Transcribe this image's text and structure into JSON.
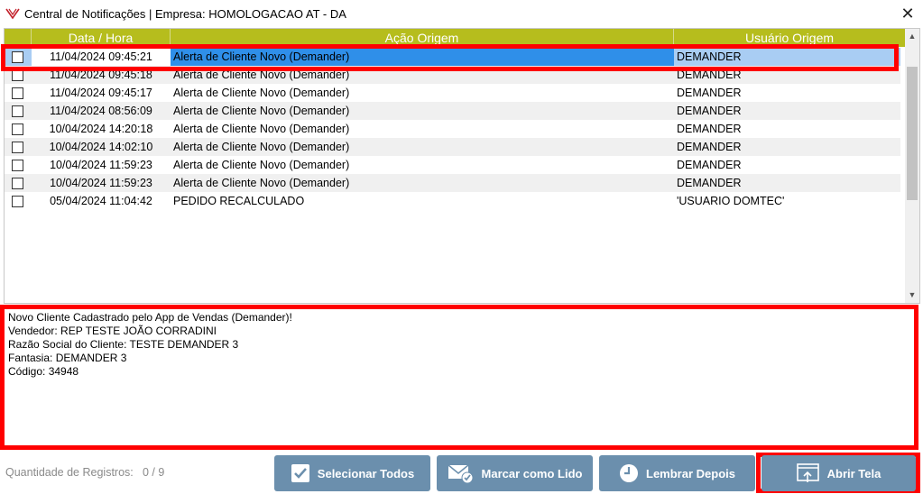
{
  "window": {
    "title": "Central de Notificações | Empresa: HOMOLOGACAO AT - DA",
    "close_label": "✕"
  },
  "grid": {
    "columns": [
      "Data / Hora",
      "Ação Origem",
      "Usuário Origem"
    ],
    "rows": [
      {
        "date": "11/04/2024 09:45:21",
        "acao": "Alerta de Cliente Novo (Demander)",
        "user": "DEMANDER",
        "checked": false,
        "selected": true
      },
      {
        "date": "11/04/2024 09:45:18",
        "acao": "Alerta de Cliente Novo (Demander)",
        "user": "DEMANDER",
        "checked": false,
        "selected": false
      },
      {
        "date": "11/04/2024 09:45:17",
        "acao": "Alerta de Cliente Novo (Demander)",
        "user": "DEMANDER",
        "checked": false,
        "selected": false
      },
      {
        "date": "11/04/2024 08:56:09",
        "acao": "Alerta de Cliente Novo (Demander)",
        "user": "DEMANDER",
        "checked": false,
        "selected": false
      },
      {
        "date": "10/04/2024 14:20:18",
        "acao": "Alerta de Cliente Novo (Demander)",
        "user": "DEMANDER",
        "checked": false,
        "selected": false
      },
      {
        "date": "10/04/2024 14:02:10",
        "acao": "Alerta de Cliente Novo (Demander)",
        "user": "DEMANDER",
        "checked": false,
        "selected": false
      },
      {
        "date": "10/04/2024 11:59:23",
        "acao": "Alerta de Cliente Novo (Demander)",
        "user": "DEMANDER",
        "checked": false,
        "selected": false
      },
      {
        "date": "10/04/2024 11:59:23",
        "acao": "Alerta de Cliente Novo (Demander)",
        "user": "DEMANDER",
        "checked": false,
        "selected": false
      },
      {
        "date": "05/04/2024 11:04:42",
        "acao": "PEDIDO RECALCULADO",
        "user": "'USUARIO DOMTEC'",
        "checked": false,
        "selected": false
      }
    ]
  },
  "message": {
    "lines": [
      "Novo Cliente Cadastrado pelo App de Vendas (Demander)!",
      "Vendedor: REP TESTE JOÃO CORRADINI",
      "Razão Social do Cliente: TESTE DEMANDER 3",
      "Fantasia: DEMANDER 3",
      "Código: 34948"
    ]
  },
  "footer": {
    "count_label": "Quantidade de Registros:",
    "count_value": "0 / 9",
    "buttons": {
      "select_all": "Selecionar Todos",
      "mark_read": "Marcar como Lido",
      "remind_later": "Lembrar Depois",
      "open_screen": "Abrir Tela"
    }
  },
  "colors": {
    "header_bg": "#b6bd1d",
    "button_bg": "#6b8fad",
    "selection": "#2f8fe9",
    "highlight": "#ff0000"
  }
}
